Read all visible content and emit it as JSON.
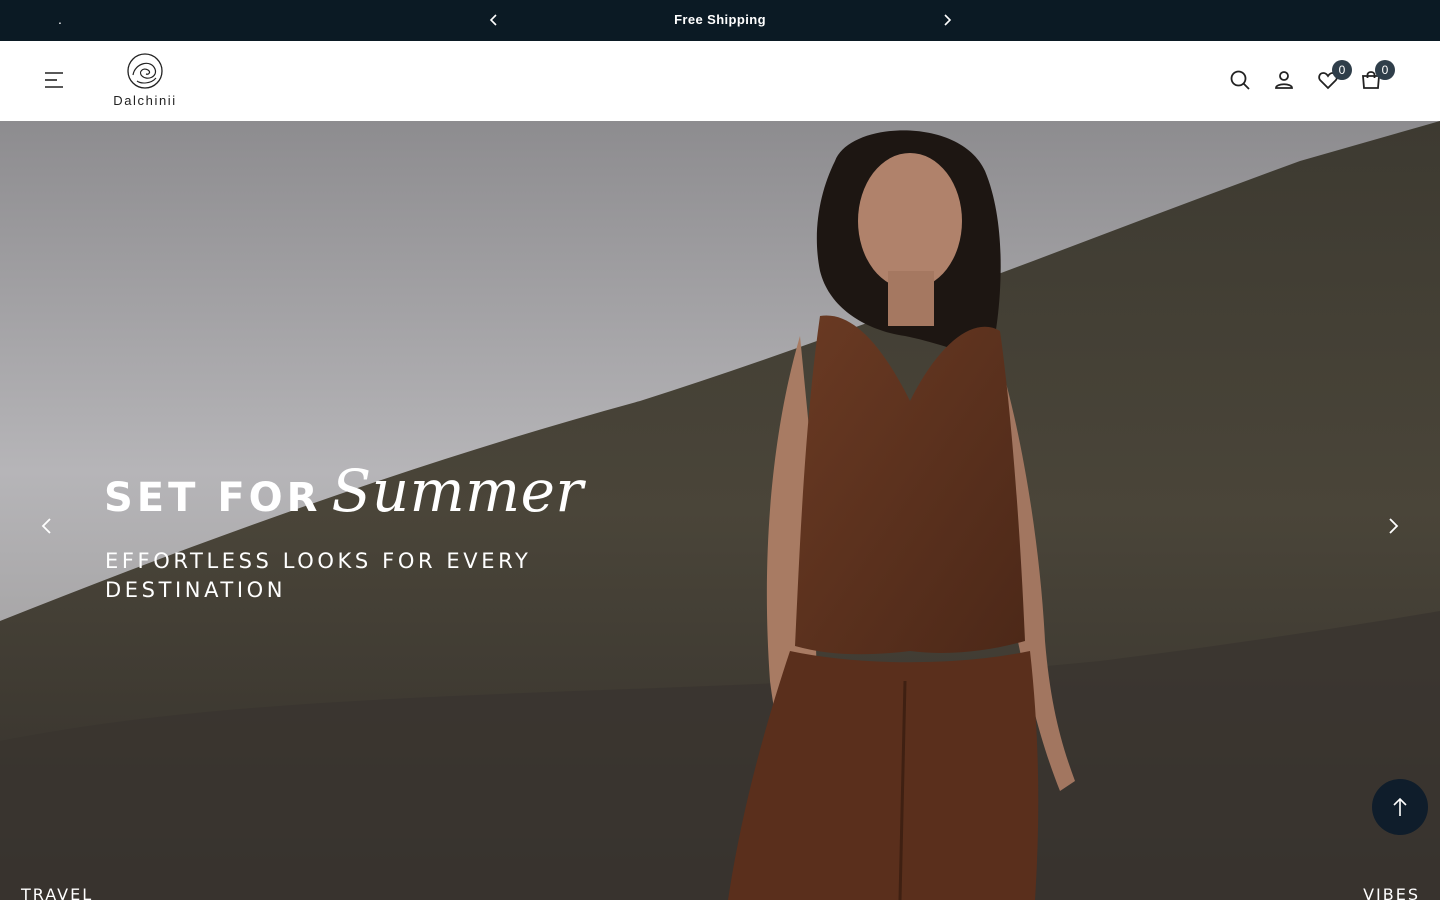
{
  "announcement": {
    "dot": ".",
    "message": "Free Shipping",
    "prev_icon": "chevron-left-icon",
    "next_icon": "chevron-right-icon",
    "background": "#0b1a24"
  },
  "header": {
    "brand": "Dalchinii",
    "icons": [
      "menu-icon",
      "search-icon",
      "user-icon",
      "heart-icon",
      "cart-icon"
    ],
    "wishlist_count": "0",
    "cart_count": "0",
    "badge_color": "#2f3e4a"
  },
  "hero": {
    "title_bold": "SET FOR",
    "title_script": "Summer",
    "subtitle": "EFFORTLESS LOOKS FOR EVERY DESTINATION",
    "corner_left": "TRAVEL",
    "corner_right": "VIBES",
    "text_color": "#ffffff"
  },
  "back_to_top": {
    "icon": "arrow-up-icon",
    "color": "#0f1d2b"
  }
}
